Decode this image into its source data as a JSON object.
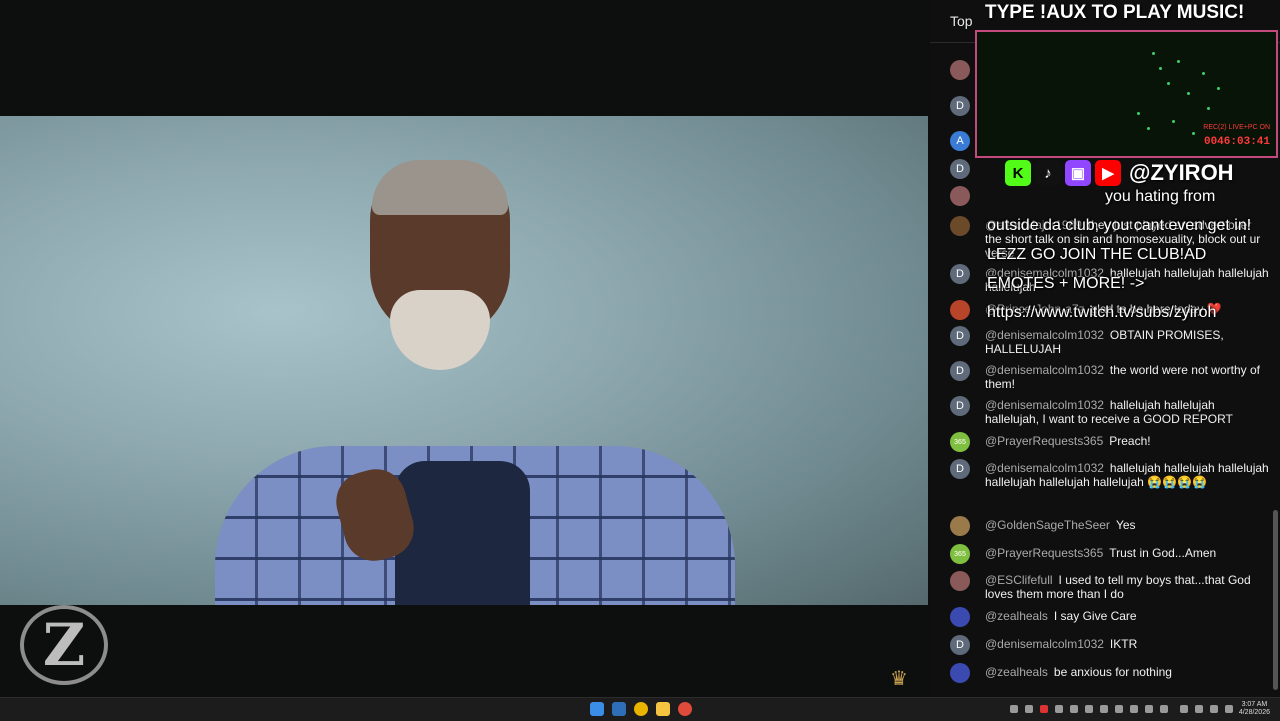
{
  "overlay": {
    "title": "TYPE !AUX TO PLAY MUSIC!",
    "rec_label": "REC(2) LIVE+PC ON",
    "rec_time": "0046:03:41",
    "handle": "@ZYIROH",
    "line1": "you hating from",
    "line2": "outside da club, you cant even get in!",
    "line3": "LEZZ GO JOIN THE  CLUB!AD",
    "line4": "EMOTES +  MORE! ->",
    "line5": "https://www.twitch.tv/subs/zyiroh"
  },
  "chat": {
    "header_tab": "Top",
    "messages": [
      {
        "author": "@alexxMajor1989",
        "text": "they just played an advert over the short talk on sin and homosexuality, block out ur verse",
        "avatar": "photo",
        "color": "#6b4a2a"
      },
      {
        "author": "@denisemalcolm1032",
        "text": "hallelujah hallelujah hallelujah hallelujah",
        "avatar": "D",
        "color": "#5f6b7a"
      },
      {
        "author": "@Prince-John-a7z",
        "text": "glad to be here today ❤️",
        "avatar": "photo",
        "color": "#b8452a"
      },
      {
        "author": "@denisemalcolm1032",
        "text": "OBTAIN PROMISES, HALLELUJAH",
        "avatar": "D",
        "color": "#5f6b7a"
      },
      {
        "author": "@denisemalcolm1032",
        "text": "the world were not worthy of them!",
        "avatar": "D",
        "color": "#5f6b7a"
      },
      {
        "author": "@denisemalcolm1032",
        "text": "hallelujah hallelujah hallelujah, I want to receive a GOOD REPORT",
        "avatar": "D",
        "color": "#5f6b7a"
      },
      {
        "author": "@PrayerRequests365",
        "text": "Preach!",
        "avatar": "365",
        "color": "#7fbf3f"
      },
      {
        "author": "@denisemalcolm1032",
        "text": "hallelujah hallelujah hallelujah hallelujah hallelujah hallelujah 😭😭😭😭",
        "avatar": "D",
        "color": "#5f6b7a"
      },
      {
        "author": "@GoldenSageTheSeer",
        "text": "Yes",
        "avatar": "photo",
        "color": "#9a7a4a"
      },
      {
        "author": "@PrayerRequests365",
        "text": "Trust in God...Amen",
        "avatar": "365",
        "color": "#7fbf3f"
      },
      {
        "author": "@ESClifefull",
        "text": "I used to tell my boys that...that God loves them more than I do",
        "avatar": "photo",
        "color": "#8a5a5a"
      },
      {
        "author": "@zealheals",
        "text": "I say Give Care",
        "avatar": "photo",
        "color": "#3a4ab0"
      },
      {
        "author": "@denisemalcolm1032",
        "text": "IKTR",
        "avatar": "D",
        "color": "#5f6b7a"
      },
      {
        "author": "@zealheals",
        "text": "be anxious for nothing",
        "avatar": "photo",
        "color": "#3a4ab0"
      }
    ],
    "side_avatars": [
      "D",
      "A",
      "D"
    ]
  },
  "taskbar": {
    "time": "3:07 AM",
    "date": "4/28/2026"
  },
  "colors": {
    "overlay_border": "#c24a7d",
    "rec_red": "#ff3a3a",
    "chat_bg": "#0f0f0f"
  }
}
